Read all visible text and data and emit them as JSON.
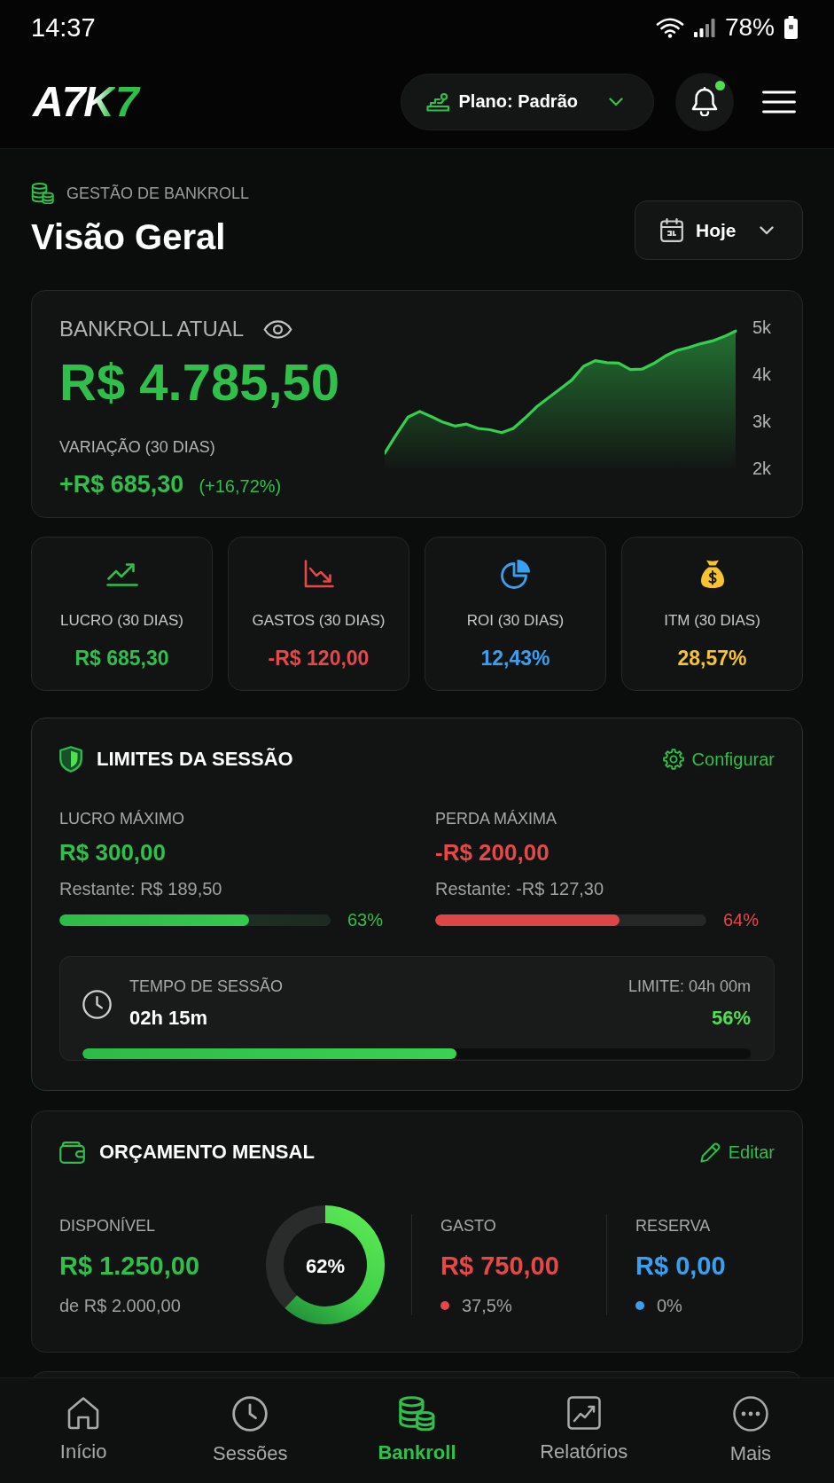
{
  "status_bar": {
    "time": "14:37",
    "battery": "78%"
  },
  "header": {
    "logo": [
      {
        "text": "A7",
        "kind": "plain"
      },
      {
        "text": "K",
        "kind": "blend"
      },
      {
        "text": "7",
        "kind": "accent"
      }
    ],
    "plan": "Plano: Padrão",
    "notifications": {
      "unread": true
    }
  },
  "page": {
    "eyebrow": "GESTÃO DE BANKROLL",
    "title": "Visão Geral",
    "period": "Hoje"
  },
  "bankroll": {
    "label": "BANKROLL ATUAL",
    "amount": "R$ 4.785,50",
    "variation_label": "VARIAÇÃO (30 DIAS)",
    "variation": "+R$ 685,30",
    "variation_percent": "(+16,72%)",
    "chart_data": {
      "type": "area",
      "categories": [
        null,
        null,
        null,
        null,
        null,
        null,
        null,
        null,
        null,
        null,
        null,
        null,
        null,
        null,
        null,
        null,
        null,
        null,
        null,
        null,
        null,
        null,
        null,
        null,
        null,
        null,
        null,
        null,
        null,
        null,
        null
      ],
      "series": [
        {
          "color": "#34cf4f",
          "values": [
            2320,
            2720,
            3090,
            3210,
            3100,
            2980,
            2900,
            2940,
            2850,
            2820,
            2760,
            2850,
            3070,
            3310,
            3500,
            3690,
            3880,
            4170,
            4290,
            4250,
            4240,
            4100,
            4110,
            4230,
            4390,
            4510,
            4570,
            4650,
            4710,
            4800,
            4920
          ]
        }
      ],
      "ylim": [
        2000,
        5000
      ],
      "yticks": [
        {
          "value": 2000,
          "label": "2k"
        },
        {
          "value": 3000,
          "label": "3k"
        },
        {
          "value": 4000,
          "label": "4k"
        },
        {
          "value": 5000,
          "label": "5k"
        }
      ]
    }
  },
  "stats": [
    {
      "kind": "profit",
      "label": "LUCRO (30 DIAS)",
      "value": "R$ 685,30",
      "color": "#2fbf4a"
    },
    {
      "kind": "expenses",
      "label": "GASTOS (30 DIAS)",
      "value": "-R$ 120,00",
      "color": "#e54848"
    },
    {
      "kind": "roi",
      "label": "ROI (30 DIAS)",
      "value": "12,43%",
      "color": "#3b9ff0"
    },
    {
      "kind": "itm",
      "label": "ITM (30 DIAS)",
      "value": "28,57%",
      "color": "#f6c431"
    }
  ],
  "session_limits": {
    "title": "LIMITES DA SESSÃO",
    "action": "Configurar",
    "limits": [
      {
        "kind": "profit",
        "label": "LUCRO MÁXIMO",
        "value": "R$ 300,00",
        "remaining": "Restante: R$ 189,50",
        "level": 0.7,
        "percent": "63%"
      },
      {
        "kind": "loss",
        "label": "PERDA MÁXIMA",
        "value": "-R$ 200,00",
        "remaining": "Restante: -R$ 127,30",
        "level": 0.68,
        "percent": "64%"
      }
    ],
    "session_time": {
      "label": "TEMPO DE SESSÃO",
      "value": "02h 15m",
      "limit": "LIMITE: 04h 00m",
      "percent": "56%",
      "level": 0.56
    }
  },
  "monthly_budget": {
    "title": "ORÇAMENTO MENSAL",
    "action": "Editar",
    "available": {
      "label": "DISPONÍVEL",
      "value": "R$ 1.250,00",
      "total": "de R$ 2.000,00"
    },
    "donut": {
      "label": "62%",
      "chart_data": {
        "type": "donut",
        "categories": [
          null,
          null
        ],
        "values": [
          62,
          38
        ]
      }
    },
    "breakdown": [
      {
        "label": "GASTO",
        "value": "R$ 750,00",
        "percent": "37,5%",
        "color": "#e54848"
      },
      {
        "label": "RESERVA",
        "value": "R$ 0,00",
        "percent": "0%",
        "color": "#3b9ff0"
      }
    ]
  },
  "bottom_nav": [
    {
      "kind": "home",
      "label": "Início",
      "selected": false
    },
    {
      "kind": "sessions",
      "label": "Sessões",
      "selected": false
    },
    {
      "kind": "bankroll",
      "label": "Bankroll",
      "selected": true
    },
    {
      "kind": "reports",
      "label": "Relatórios",
      "selected": false
    },
    {
      "kind": "more",
      "label": "Mais",
      "selected": false
    }
  ]
}
